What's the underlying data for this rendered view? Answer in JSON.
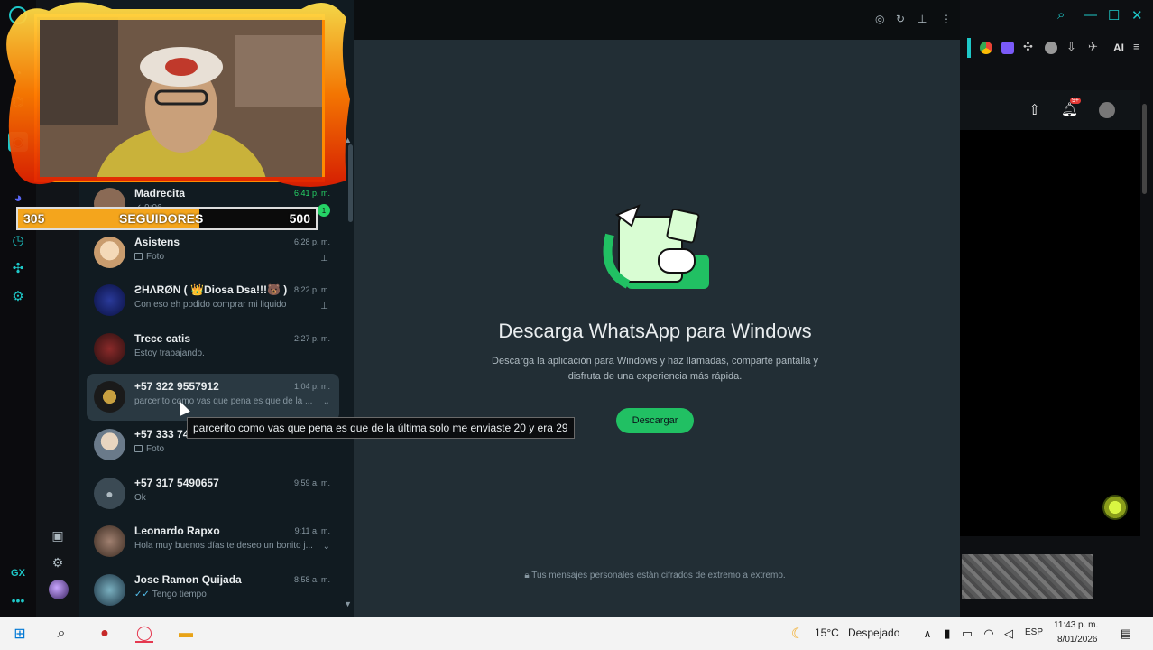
{
  "overlay": {
    "followers_current": "305",
    "followers_label": "SEGUIDORES",
    "followers_goal": "500",
    "followers_progress": 0.61
  },
  "gx_sidebar": {
    "gx_label": "GX",
    "more_label": "•••"
  },
  "chats": [
    {
      "name": "Madrecita",
      "time": "6:41 p. m.",
      "preview": "✓ 9:06",
      "badge": "1",
      "time_unread": true
    },
    {
      "name": "Asistens",
      "time": "6:28 p. m.",
      "preview": "Foto",
      "pinned": true
    },
    {
      "name": "ƧHΛRØN ( 👑Diosa Dsa!!!🐻 )",
      "time": "8:22 p. m.",
      "preview": "Con eso eh podido comprar mi liquido",
      "pinned": true
    },
    {
      "name": "Trece catis",
      "time": "2:27 p. m.",
      "preview": "Estoy trabajando."
    },
    {
      "name": "+57 322 9557912",
      "time": "1:04 p. m.",
      "preview": "parcerito como vas que  pena es que de la ..."
    },
    {
      "name": "+57 333 74",
      "time": "",
      "preview": "Foto"
    },
    {
      "name": "+57 317 5490657",
      "time": "9:59 a. m.",
      "preview": "Ok"
    },
    {
      "name": "Leonardo Rapxo",
      "time": "9:11 a. m.",
      "preview": "Hola muy buenos días te deseo un bonito j..."
    },
    {
      "name": "Jose Ramon Quijada",
      "time": "8:58 a. m.",
      "preview": "Tengo tiempo"
    }
  ],
  "tooltip": "parcerito como vas que  pena es que de la última solo me enviaste 20 y era 29",
  "welcome": {
    "title": "Descarga WhatsApp para Windows",
    "description": "Descarga la aplicación para Windows y haz llamadas, comparte pantalla y disfruta de una experiencia más rápida.",
    "button": "Descargar",
    "encrypted": "Tus mensajes personales están cifrados de extremo a extremo."
  },
  "right_panel": {
    "ai_label": "AI",
    "notif_badge": "9+"
  },
  "taskbar": {
    "weather_temp": "15°C",
    "weather_text": "Despejado",
    "language": "ESP",
    "time": "11:43 p. m.",
    "date": "8/01/2026"
  },
  "colors": {
    "accent": "#1ec8c8",
    "whatsapp_green": "#21c063",
    "follower_fill": "#f4a51c"
  }
}
